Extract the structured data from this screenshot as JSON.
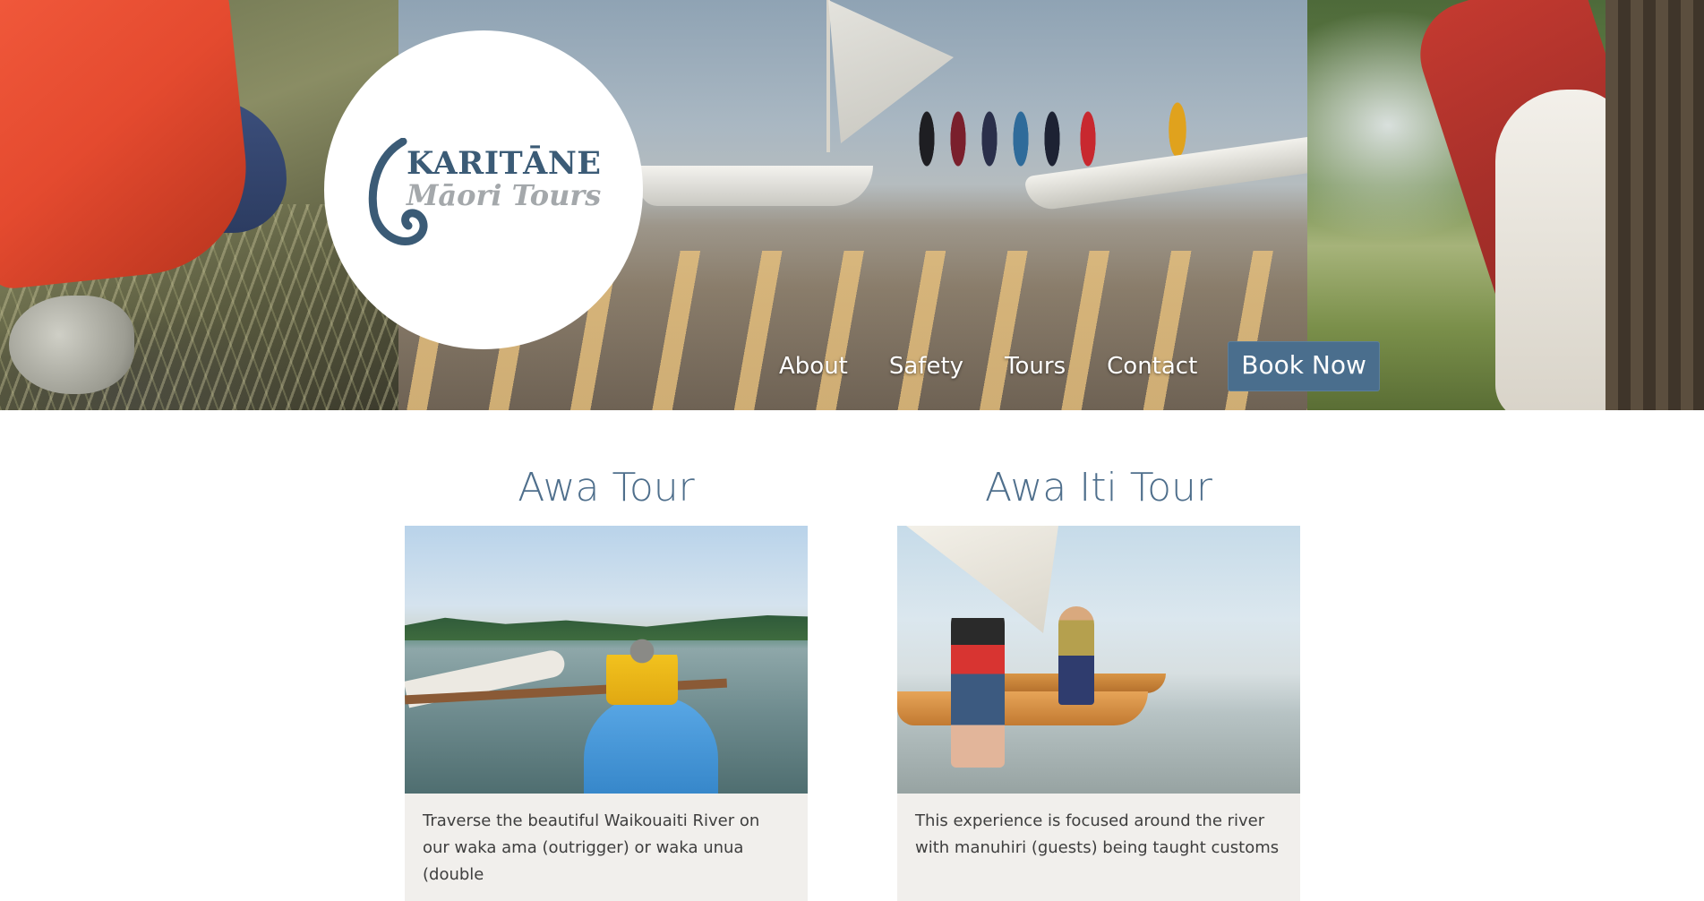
{
  "brand": {
    "name": "KARITĀNE",
    "subtitle": "Māori Tours",
    "primary_color": "#4a6e8d",
    "logo_icon": "koru-hook-icon"
  },
  "nav": {
    "items": [
      {
        "label": "About"
      },
      {
        "label": "Safety"
      },
      {
        "label": "Tours"
      },
      {
        "label": "Contact"
      }
    ],
    "cta_label": "Book Now"
  },
  "tours": [
    {
      "title": "Awa Tour",
      "description": "Traverse the beautiful Waikouaiti River on our waka ama (outrigger) or waka unua (double"
    },
    {
      "title": "Awa Iti Tour",
      "description": "This experience is focused around the river with manuhiri (guests) being taught customs"
    }
  ]
}
